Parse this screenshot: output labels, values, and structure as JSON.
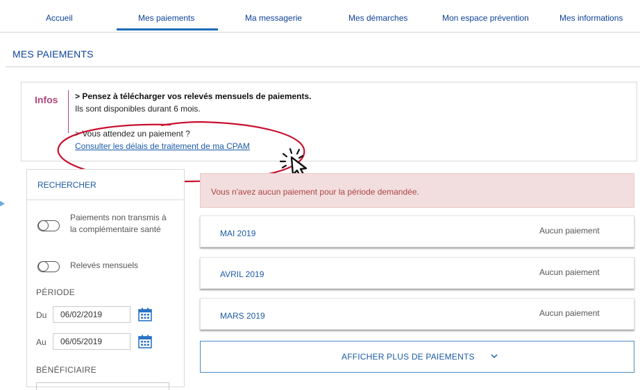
{
  "nav": {
    "items": [
      {
        "label": "Accueil"
      },
      {
        "label": "Mes paiements"
      },
      {
        "label": "Ma messagerie"
      },
      {
        "label": "Mes démarches"
      },
      {
        "label": "Mon espace prévention"
      },
      {
        "label": "Mes informations"
      }
    ],
    "active_index": 1
  },
  "page": {
    "title": "MES PAIEMENTS"
  },
  "infos": {
    "label": "Infos",
    "line1": "> Pensez à télécharger vos relevés mensuels de paiements.",
    "line2": "Ils sont disponibles durant 6 mois.",
    "line3": "> Vous attendez un paiement ?",
    "link": "Consulter les délais de traitement de ma CPAM"
  },
  "search": {
    "title": "RECHERCHER",
    "toggle1_label": "Paiements non transmis à la complémentaire santé",
    "toggle2_label": "Relevés mensuels",
    "period_label": "PÉRIODE",
    "from_prefix": "Du",
    "from_value": "06/02/2019",
    "to_prefix": "Au",
    "to_value": "06/05/2019",
    "beneficiary_label": "BÉNÉFICIAIRE"
  },
  "alert": {
    "text": "Vous n'avez aucun paiement pour la période demandée."
  },
  "payments": [
    {
      "month": "MAI 2019",
      "status": "Aucun paiement"
    },
    {
      "month": "AVRIL 2019",
      "status": "Aucun paiement"
    },
    {
      "month": "MARS 2019",
      "status": "Aucun paiement"
    }
  ],
  "more_button": {
    "label": "AFFICHER PLUS DE PAIEMENTS"
  },
  "colors": {
    "primary": "#1a5aa6",
    "nav_text": "#0c419a",
    "infos_accent": "#b0457c",
    "alert_bg": "#f2dede",
    "alert_text": "#a94442",
    "annotation": "#c8102e"
  },
  "icons": {
    "calendar": "calendar-icon",
    "chevron": "chevron-down-icon",
    "cursor": "pointer-click-icon"
  }
}
